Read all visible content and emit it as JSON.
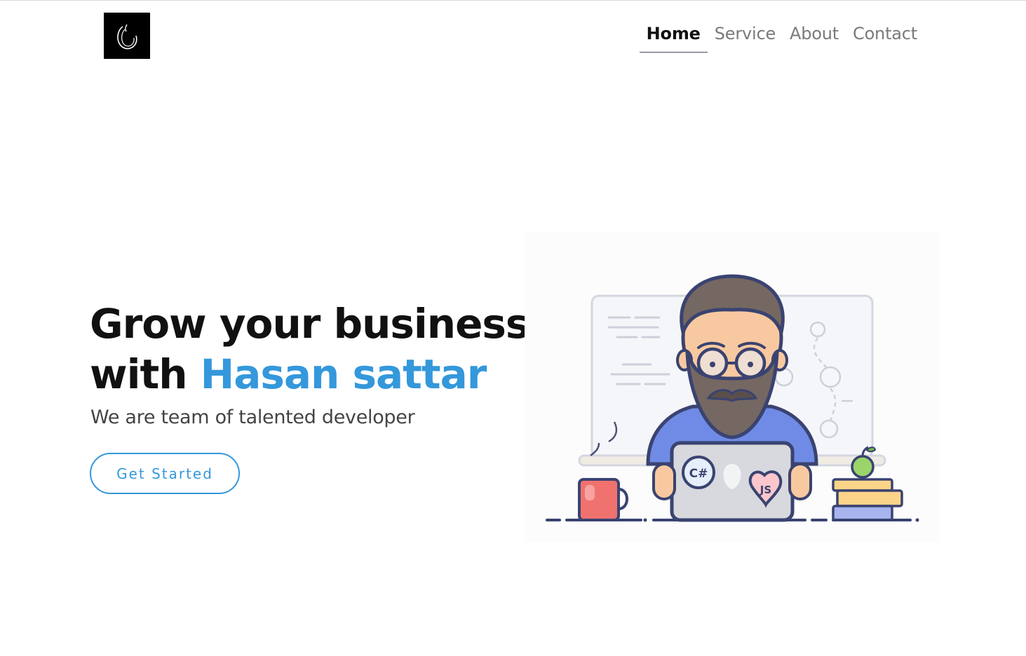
{
  "header": {
    "logo_icon": "ring-logo-icon",
    "nav": [
      {
        "label": "Home",
        "active": true
      },
      {
        "label": "Service",
        "active": false
      },
      {
        "label": "About",
        "active": false
      },
      {
        "label": "Contact",
        "active": false
      }
    ]
  },
  "hero": {
    "title_line1": "Grow your business",
    "title_line2_prefix": "with ",
    "title_highlight": "Hasan sattar",
    "subtitle": "We are team of talented developer",
    "cta_label": "Get Started"
  },
  "illustration": {
    "icon": "developer-at-laptop-illustration",
    "sticker1": "C#",
    "sticker2": "JS"
  },
  "colors": {
    "accent": "#3498db",
    "text": "#111111",
    "muted": "#7a7a7a"
  }
}
